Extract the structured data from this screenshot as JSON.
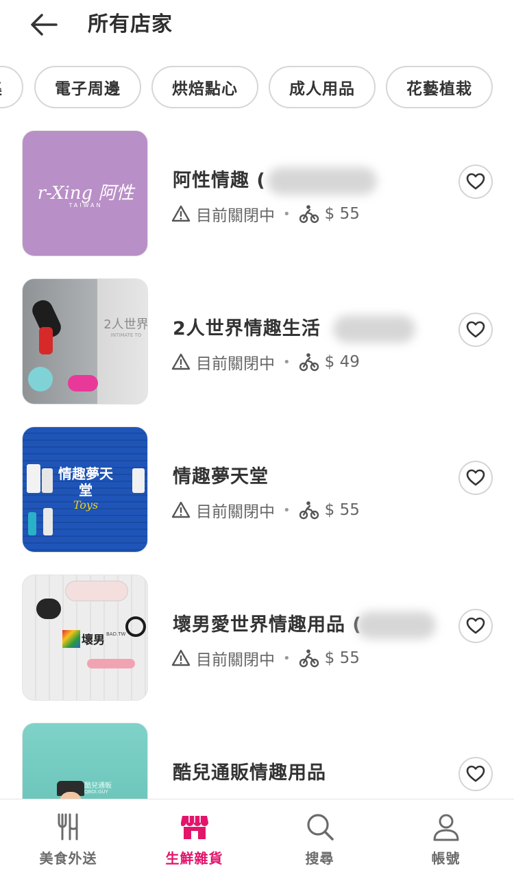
{
  "header": {
    "title": "所有店家"
  },
  "categories": [
    {
      "label": "集"
    },
    {
      "label": "電子周邊"
    },
    {
      "label": "烘焙點心"
    },
    {
      "label": "成人用品"
    },
    {
      "label": "花藝植栽"
    }
  ],
  "stores": [
    {
      "name": "阿性情趣 (",
      "status": "目前關閉中",
      "delivery_fee": "$ 55",
      "logo_text": "r-Xing 阿性",
      "logo_sub": "TAIWAN",
      "favorited": false
    },
    {
      "name": "2人世界情趣生活",
      "status": "目前關閉中",
      "delivery_fee": "$ 49",
      "logo_text": "2人世界",
      "logo_sub": "INTIMATE TO",
      "favorited": false
    },
    {
      "name": "情趣夢天堂",
      "status": "目前關閉中",
      "delivery_fee": "$ 55",
      "logo_text": "情趣夢天堂",
      "logo_sub": "Toys",
      "favorited": false
    },
    {
      "name": "壞男愛世界情趣用品 (",
      "status": "目前關閉中",
      "delivery_fee": "$ 55",
      "logo_text": "壞男",
      "logo_sub": "BAD.TW",
      "favorited": false
    },
    {
      "name": "酷兒通販情趣用品",
      "status": "",
      "delivery_fee": "",
      "logo_text": "酷兒通販",
      "logo_sub": "QBOI.GUY",
      "favorited": false
    }
  ],
  "bottom_nav": [
    {
      "label": "美食外送",
      "icon": "utensils-icon",
      "active": false
    },
    {
      "label": "生鮮雜貨",
      "icon": "store-icon",
      "active": true
    },
    {
      "label": "搜尋",
      "icon": "search-icon",
      "active": false
    },
    {
      "label": "帳號",
      "icon": "person-icon",
      "active": false
    }
  ],
  "colors": {
    "brand": "#e2156b",
    "text": "#333333",
    "muted": "#666666",
    "border": "#d6d6d6"
  }
}
